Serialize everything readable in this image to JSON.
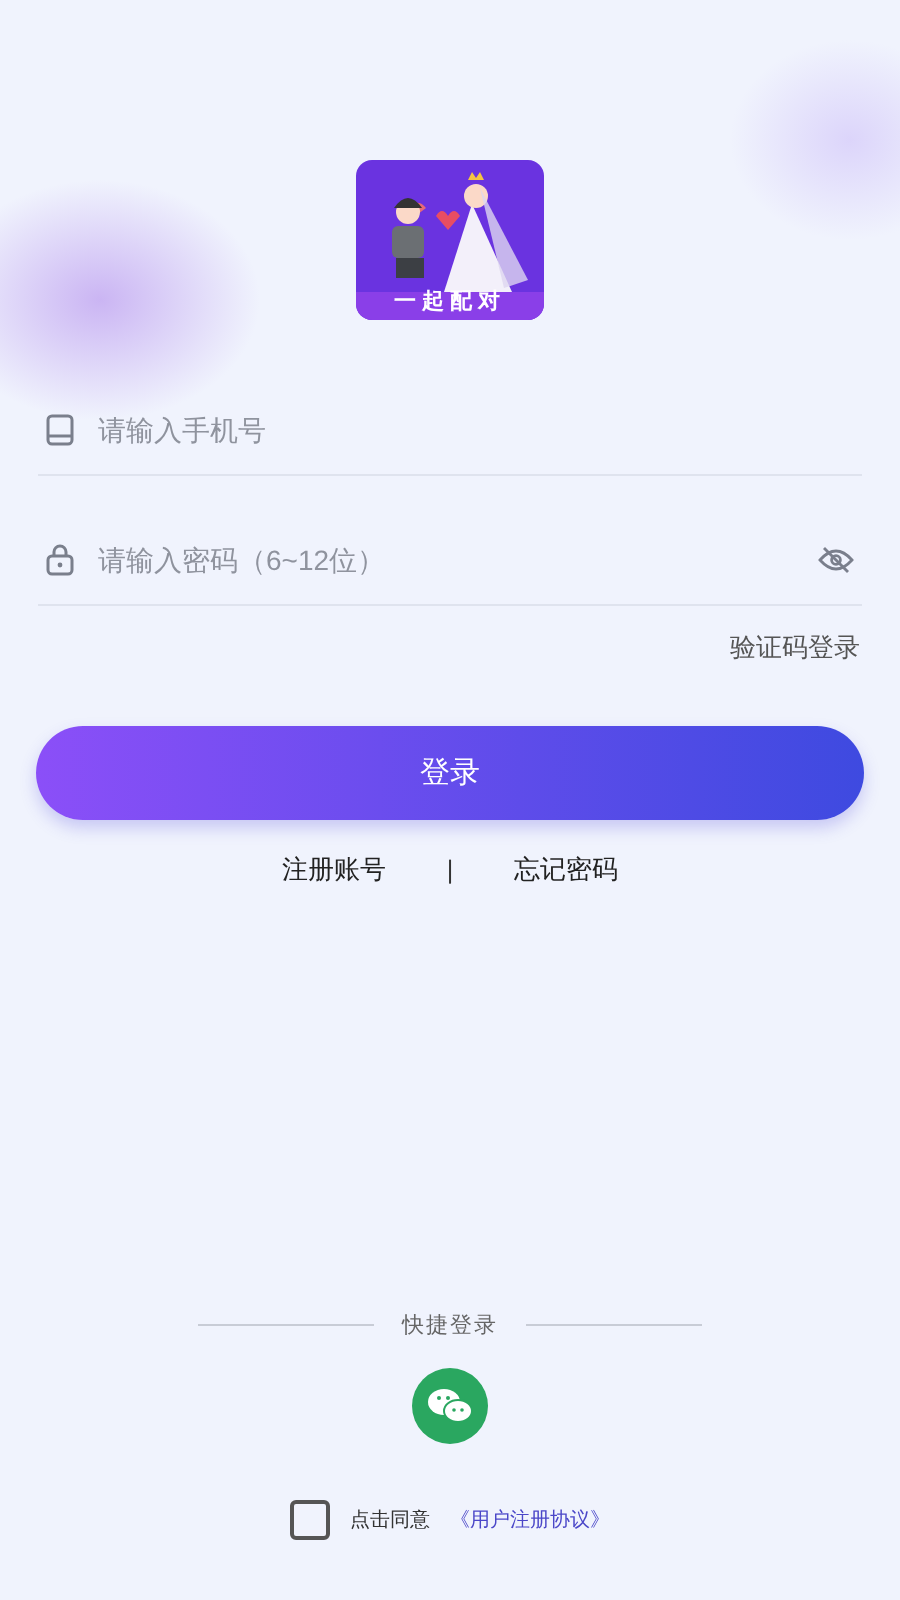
{
  "logo": {
    "caption": "一起配对"
  },
  "phone_field": {
    "placeholder": "请输入手机号"
  },
  "password_field": {
    "placeholder": "请输入密码（6~12位）",
    "password_visible": false
  },
  "code_login_link": "验证码登录",
  "login_button": "登录",
  "links": [
    {
      "label": "注册账号"
    },
    {
      "label": "忘记密码"
    }
  ],
  "link_separator": "|",
  "quick_login": {
    "title": "快捷登录"
  },
  "agreement": {
    "checked": false,
    "text": "点击同意",
    "link": "《用户注册协议》"
  }
}
